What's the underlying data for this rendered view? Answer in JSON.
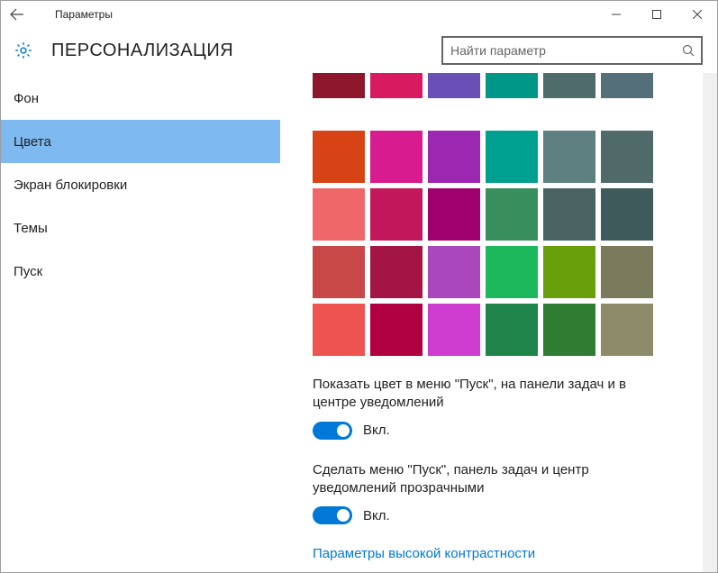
{
  "window_title": "Параметры",
  "header": {
    "title": "ПЕРСОНАЛИЗАЦИЯ",
    "search_placeholder": "Найти параметр"
  },
  "sidebar": {
    "items": [
      {
        "label": "Фон",
        "selected": false
      },
      {
        "label": "Цвета",
        "selected": true
      },
      {
        "label": "Экран блокировки",
        "selected": false
      },
      {
        "label": "Темы",
        "selected": false
      },
      {
        "label": "Пуск",
        "selected": false
      }
    ]
  },
  "colors": {
    "rows": [
      [
        "#8e162c",
        "#d81b60",
        "#6a4fb6",
        "#009688",
        "#4f6b6b",
        "#546e7a"
      ],
      [
        "#d84315",
        "#d81b8f",
        "#9c27b0",
        "#00a090",
        "#5f8080",
        "#506a6a"
      ],
      [
        "#f0676a",
        "#c2185b",
        "#a0006e",
        "#388e5c",
        "#4a6363",
        "#3e5a5a"
      ],
      [
        "#c84848",
        "#a31545",
        "#ab47bc",
        "#1eb85c",
        "#689f0a",
        "#7a7a5c"
      ],
      [
        "#ef5350",
        "#b00040",
        "#ce3bcf",
        "#1e8449",
        "#2e7d32",
        "#8d8b6a"
      ]
    ]
  },
  "settings": {
    "show_color": {
      "label": "Показать цвет в меню \"Пуск\", на панели задач и в центре уведомлений",
      "state": "Вкл.",
      "on": true
    },
    "transparent": {
      "label": "Сделать меню \"Пуск\", панель задач и центр уведомлений прозрачными",
      "state": "Вкл.",
      "on": true
    }
  },
  "high_contrast_link": "Параметры высокой контрастности"
}
